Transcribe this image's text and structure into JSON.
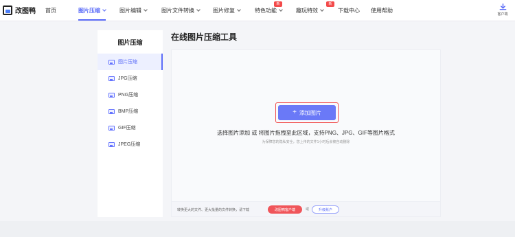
{
  "app": {
    "name": "改图鸭"
  },
  "nav": {
    "items": [
      {
        "label": "首页",
        "dropdown": false,
        "active": false
      },
      {
        "label": "图片压缩",
        "dropdown": true,
        "active": true
      },
      {
        "label": "图片编辑",
        "dropdown": true,
        "active": false
      },
      {
        "label": "图片文件转换",
        "dropdown": true,
        "active": false
      },
      {
        "label": "图片修复",
        "dropdown": true,
        "active": false
      },
      {
        "label": "特色功能",
        "dropdown": true,
        "active": false,
        "badge": "新"
      },
      {
        "label": "趣玩特效",
        "dropdown": true,
        "active": false,
        "badge": "新"
      },
      {
        "label": "下载中心",
        "dropdown": false,
        "active": false
      },
      {
        "label": "使用帮助",
        "dropdown": false,
        "active": false
      }
    ],
    "client_label": "客户端",
    "client_icon": "download-icon"
  },
  "sidebar": {
    "title": "图片压缩",
    "items": [
      {
        "label": "图片压缩",
        "active": true,
        "icon": "image-icon"
      },
      {
        "label": "JPG压缩",
        "active": false,
        "icon": "image-icon"
      },
      {
        "label": "PNG压缩",
        "active": false,
        "icon": "image-icon"
      },
      {
        "label": "BMP压缩",
        "active": false,
        "icon": "image-icon"
      },
      {
        "label": "GIF压缩",
        "active": false,
        "icon": "image-icon"
      },
      {
        "label": "JPEG压缩",
        "active": false,
        "icon": "image-icon"
      }
    ]
  },
  "main": {
    "title": "在线图片压缩工具",
    "add_button": "添加图片",
    "hint": "选择图片添加 或 将图片拖拽至此区域，支持PNG、JPG、GIF等图片格式",
    "sub_hint": "为保障您的隐私安全，您上传的文件1小时后会被自动删除",
    "bottom": {
      "text": "转换更大的文件、更大批量的文件转换，请下载",
      "client_button": "改图鸭客户端",
      "or": "或",
      "upgrade_button": "升级账户"
    }
  },
  "colors": {
    "accent": "#5b6cf8",
    "button": "#6a79f7",
    "badge": "#f34a4a",
    "client_button": "#f0555a"
  }
}
